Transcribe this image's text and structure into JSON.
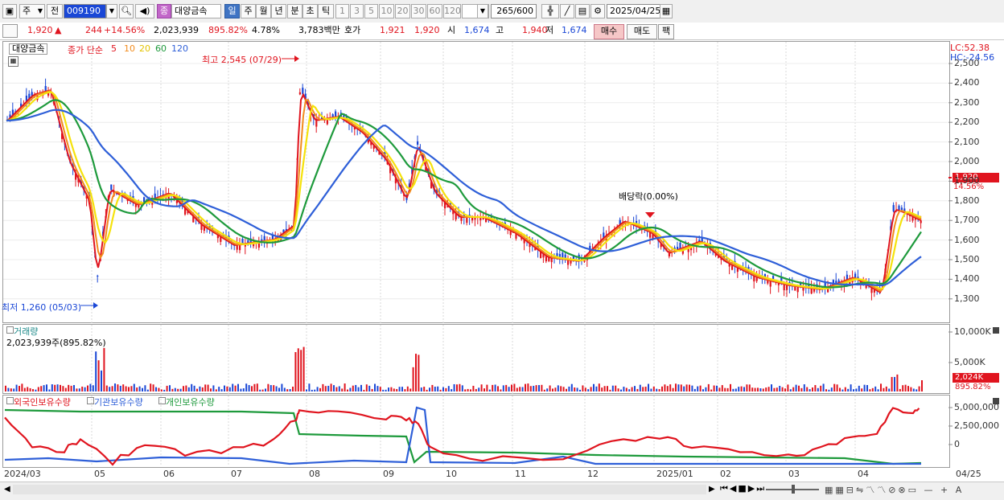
{
  "toolbar": {
    "unit_label": "주",
    "prev_label": "전",
    "code": "009190",
    "stock_badge": "종",
    "stock_name": "대양금속",
    "period_tabs": [
      "일",
      "주",
      "월",
      "년",
      "분",
      "초",
      "틱"
    ],
    "numbers": [
      "1",
      "3",
      "5",
      "10",
      "20",
      "30",
      "60",
      "120"
    ],
    "range": "265/600",
    "date": "2025/04/25"
  },
  "quote": {
    "price": "1,920",
    "change": "244",
    "change_pct": "+14.56%",
    "volume": "2,023,939",
    "vol_ratio": "895.82%",
    "turnover": "4.78%",
    "amount": "3,783백만",
    "hoga_label": "호가",
    "ask": "1,921",
    "bid": "1,920",
    "open_label": "시",
    "open": "1,674",
    "high_label": "고",
    "high": "1,940",
    "low_label": "저",
    "low": "1,674",
    "buy_label": "매수",
    "sell_label": "매도",
    "fix_label": "팩"
  },
  "price_panel": {
    "name": "대양금속",
    "legend_main": "종가 단순",
    "ma_labels": [
      "5",
      "10",
      "20",
      "60",
      "120"
    ],
    "ma_colors": [
      "#e0141e",
      "#f28c1e",
      "#f5e20b",
      "#1e9a3c",
      "#2e5fd8"
    ],
    "lc": "LC:52.38",
    "hc": "HC:-24.56",
    "high_note": "최고 2,545 (07/29)",
    "low_note": "최저 1,260 (05/03)",
    "dividend_note": "배당락(0.00%)",
    "price_tag": "1,920",
    "pct_tag": "14.56%",
    "y_ticks": [
      "2,500",
      "2,400",
      "2,300",
      "2,200",
      "2,100",
      "2,000",
      "1,900",
      "1,800",
      "1,700",
      "1,600",
      "1,500",
      "1,400",
      "1,300"
    ]
  },
  "volume_panel": {
    "title": "거래량",
    "value": "2,023,939주(895.82%)",
    "y_ticks": [
      "10,000K",
      "5,000K"
    ],
    "tag_value": "2,024K",
    "tag_pct": "895.82%"
  },
  "holding_panel": {
    "labels": [
      "외국인보유수량",
      "기관보유수량",
      "개인보유수량"
    ],
    "colors": [
      "#e0141e",
      "#2e5fd8",
      "#1e9a3c"
    ],
    "y_ticks": [
      "5,000,000",
      "2,500,000",
      "0"
    ]
  },
  "x_axis": [
    "2024/03",
    "05",
    "06",
    "07",
    "08",
    "09",
    "10",
    "11",
    "12",
    "2025/01",
    "02",
    "03",
    "04",
    "04/25"
  ],
  "colors": {
    "up": "#e0141e",
    "down": "#1a47d6",
    "accent": "#3f74c4"
  }
}
